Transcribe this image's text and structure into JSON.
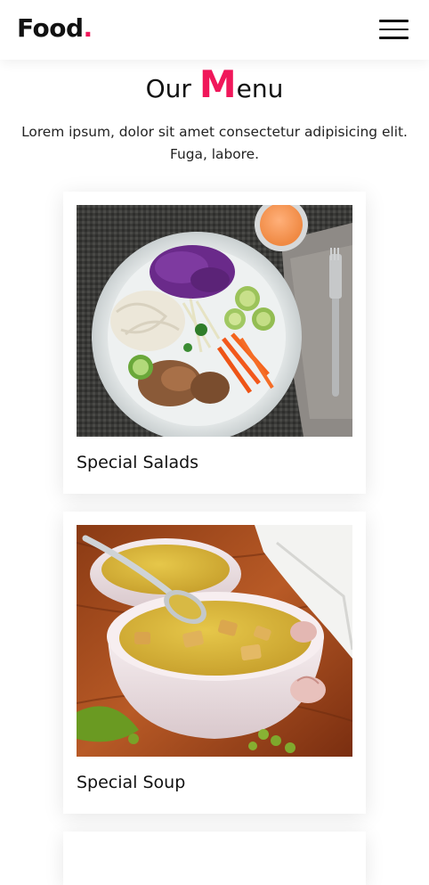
{
  "header": {
    "logo_text": "Food",
    "logo_dot": ".",
    "menu_label": "menu"
  },
  "section": {
    "title_before": "Our ",
    "title_highlight": "M",
    "title_after": "enu",
    "description": "Lorem ipsum, dolor sit amet consectetur adipisicing elit. Fuga, labore."
  },
  "menu_items": [
    {
      "name": "Special Salads",
      "image": "salad-bowl"
    },
    {
      "name": "Special Soup",
      "image": "soup-bowl"
    }
  ],
  "colors": {
    "accent": "#f0175a",
    "text": "#111111",
    "background": "#ffffff"
  }
}
